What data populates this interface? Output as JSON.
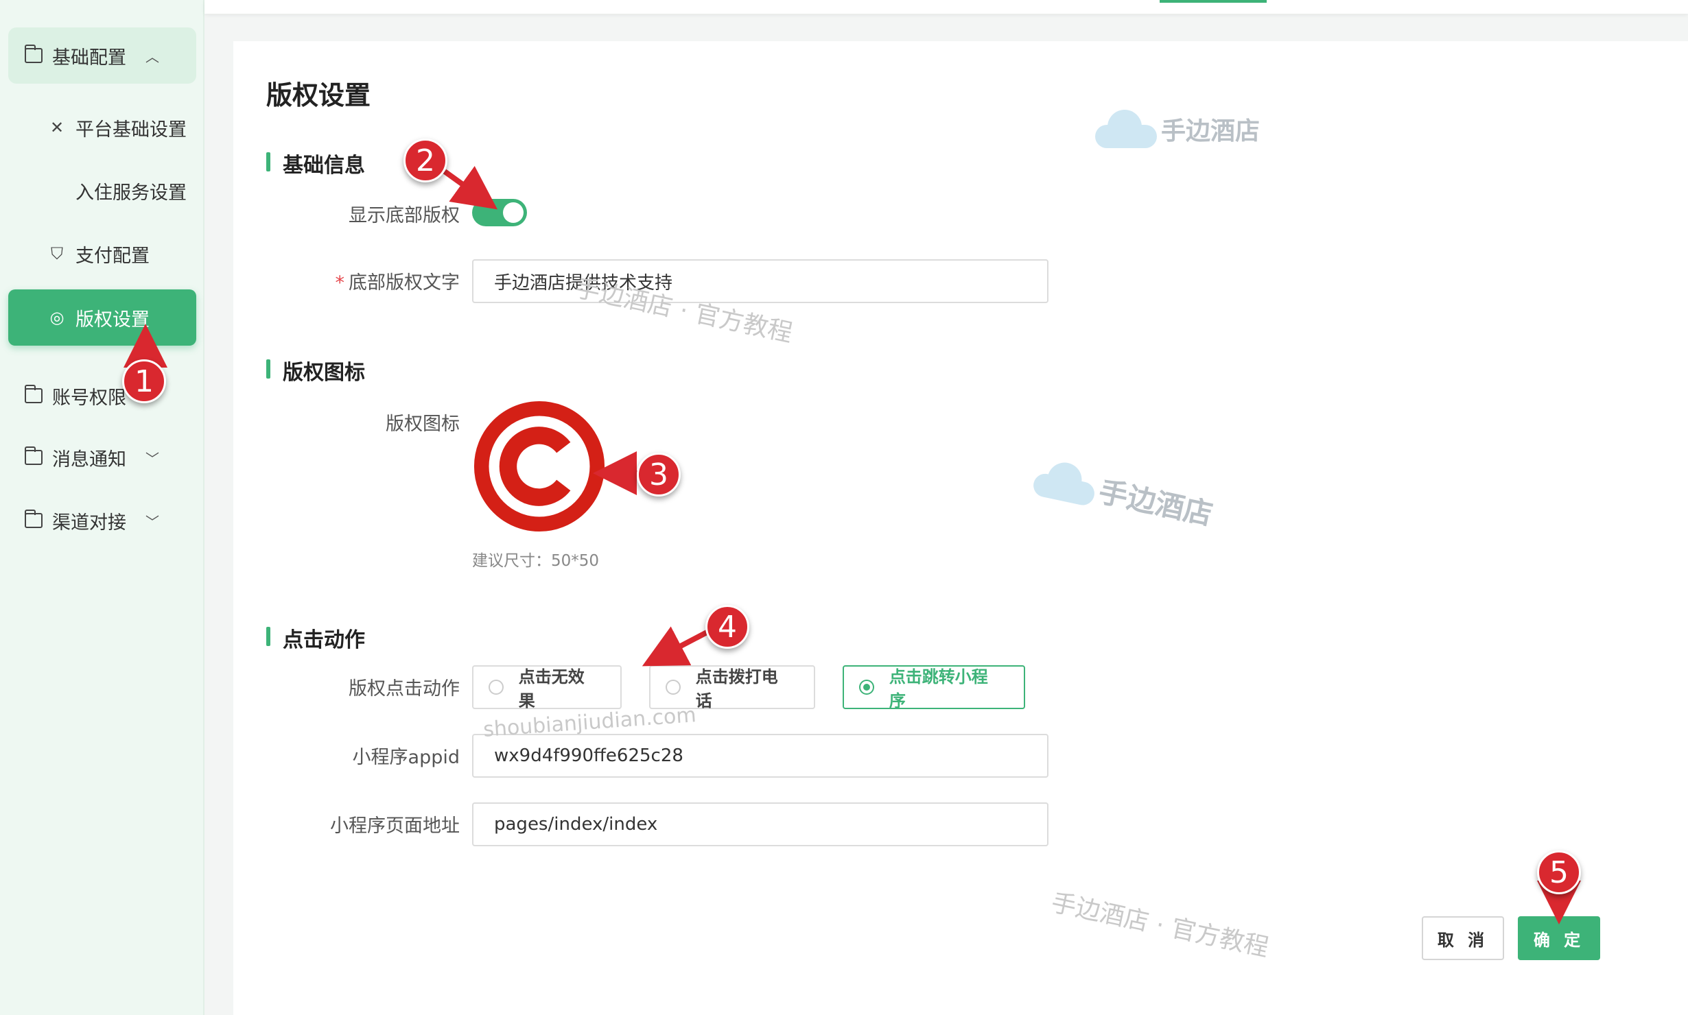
{
  "sidebar": {
    "groups": [
      {
        "label": "基础配置",
        "chevron": "^"
      },
      {
        "label": "账号权限"
      },
      {
        "label": "消息通知",
        "chevron": "v"
      },
      {
        "label": "渠道对接",
        "chevron": "v"
      }
    ],
    "sub_items": [
      {
        "label": "平台基础设置",
        "icon": "tools-icon"
      },
      {
        "label": "入住服务设置"
      },
      {
        "label": "支付配置",
        "icon": "shield-icon"
      },
      {
        "label": "版权设置",
        "icon": "circle-icon",
        "active": true
      }
    ]
  },
  "page": {
    "title": "版权设置",
    "sections": {
      "basic": "基础信息",
      "icon": "版权图标",
      "action": "点击动作"
    },
    "fields": {
      "show_copyright_label": "显示底部版权",
      "copyright_text_label": "底部版权文字",
      "copyright_text_required": "*",
      "copyright_text_value": "手边酒店提供技术支持",
      "copyright_icon_label": "版权图标",
      "icon_hint": "建议尺寸：50*50",
      "click_action_label": "版权点击动作",
      "appid_label": "小程序appid",
      "appid_value": "wx9d4f990ffe625c28",
      "page_path_label": "小程序页面地址",
      "page_path_value": "pages/index/index"
    },
    "click_options": [
      {
        "label": "点击无效果",
        "selected": false
      },
      {
        "label": "点击拨打电话",
        "selected": false
      },
      {
        "label": "点击跳转小程序",
        "selected": true
      }
    ],
    "buttons": {
      "cancel": "取 消",
      "confirm": "确 定"
    },
    "toggle_on": true
  },
  "watermarks": {
    "brand": "手边酒店",
    "tutorial": "手边酒店 · 官方教程",
    "domain": "shoubianjiudian.com"
  },
  "callouts": [
    "1",
    "2",
    "3",
    "4",
    "5"
  ],
  "colors": {
    "accent": "#3db378",
    "callout_red": "#d9282f",
    "copyright_red": "#d42016"
  }
}
